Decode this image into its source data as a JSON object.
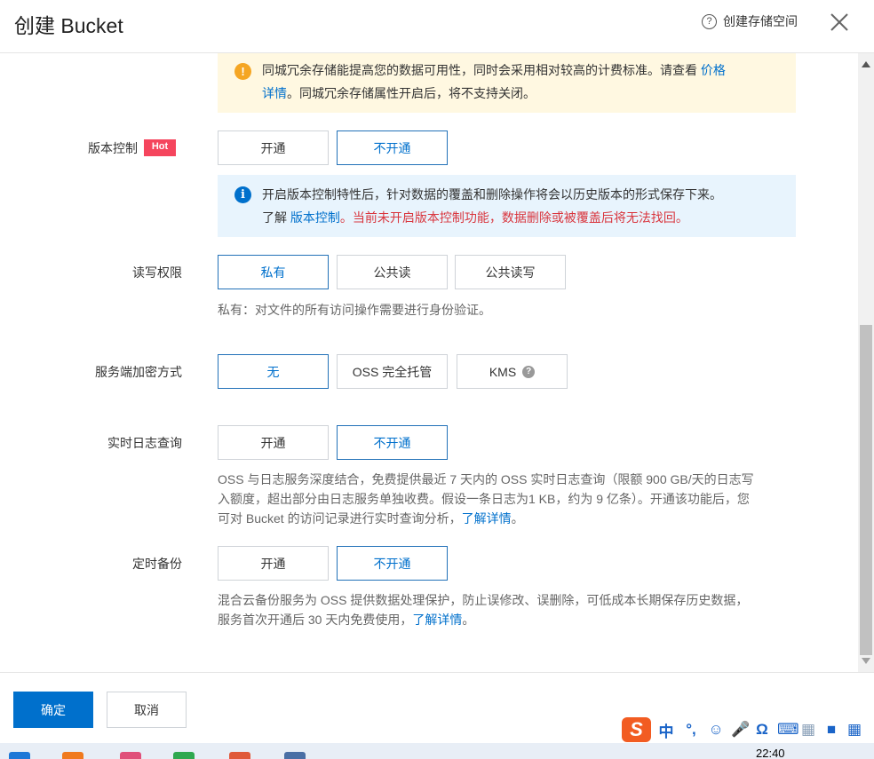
{
  "header": {
    "title": "创建 Bucket",
    "help_link": "创建存储空间"
  },
  "redundancy": {
    "warning_text_1": "同城冗余存储能提高您的数据可用性，同时会采用相对较高的计费标准。请查看",
    "warning_link_1": "价格",
    "warning_link_2": "详情",
    "warning_text_2": "。同城冗余存储属性开启后，将不支持关闭。"
  },
  "versioning": {
    "label": "版本控制",
    "badge": "Hot",
    "options": [
      "开通",
      "不开通"
    ],
    "selected": "不开通",
    "info_text": "开启版本控制特性后，针对数据的覆盖和删除操作将会以历史版本的形式保存下来。",
    "info_prefix": "了解",
    "info_link": "版本控制",
    "info_warning": "。当前未开启版本控制功能，数据删除或被覆盖后将无法找回。"
  },
  "acl": {
    "label": "读写权限",
    "options": [
      "私有",
      "公共读",
      "公共读写"
    ],
    "selected": "私有",
    "desc": "私有：对文件的所有访问操作需要进行身份验证。"
  },
  "encryption": {
    "label": "服务端加密方式",
    "options": [
      "无",
      "OSS 完全托管",
      "KMS"
    ],
    "selected": "无"
  },
  "realtime_log": {
    "label": "实时日志查询",
    "options": [
      "开通",
      "不开通"
    ],
    "selected": "不开通",
    "desc_line_1": "OSS 与日志服务深度结合，免费提供最近 7 天内的 OSS 实时日志查询（限额 900 GB/天的日志写",
    "desc_line_2": "入额度，超出部分由日志服务单独收费。假设一条日志为1 KB，约为 9 亿条）。开通该功能后，您",
    "desc_line_3": "可对 Bucket 的访问记录进行实时查询分析，",
    "desc_link": "了解详情",
    "desc_end": "。"
  },
  "backup": {
    "label": "定时备份",
    "options": [
      "开通",
      "不开通"
    ],
    "selected": "不开通",
    "desc_line_1": "混合云备份服务为 OSS 提供数据处理保护，防止误修改、误删除，可低成本长期保存历史数据，",
    "desc_line_2": "服务首次开通后 30 天内免费使用，",
    "desc_link": "了解详情",
    "desc_end": "。"
  },
  "footer": {
    "ok": "确定",
    "cancel": "取消"
  },
  "ime": {
    "logo": "S",
    "mode": "中",
    "punct": "°,"
  },
  "taskbar": {
    "clock": "22:40"
  },
  "colors": {
    "primary": "#0070cc",
    "warning_bg": "#fff8e1",
    "info_bg": "#e8f4fd",
    "hot_badge": "#f5455d",
    "danger_text": "#d9363e"
  }
}
